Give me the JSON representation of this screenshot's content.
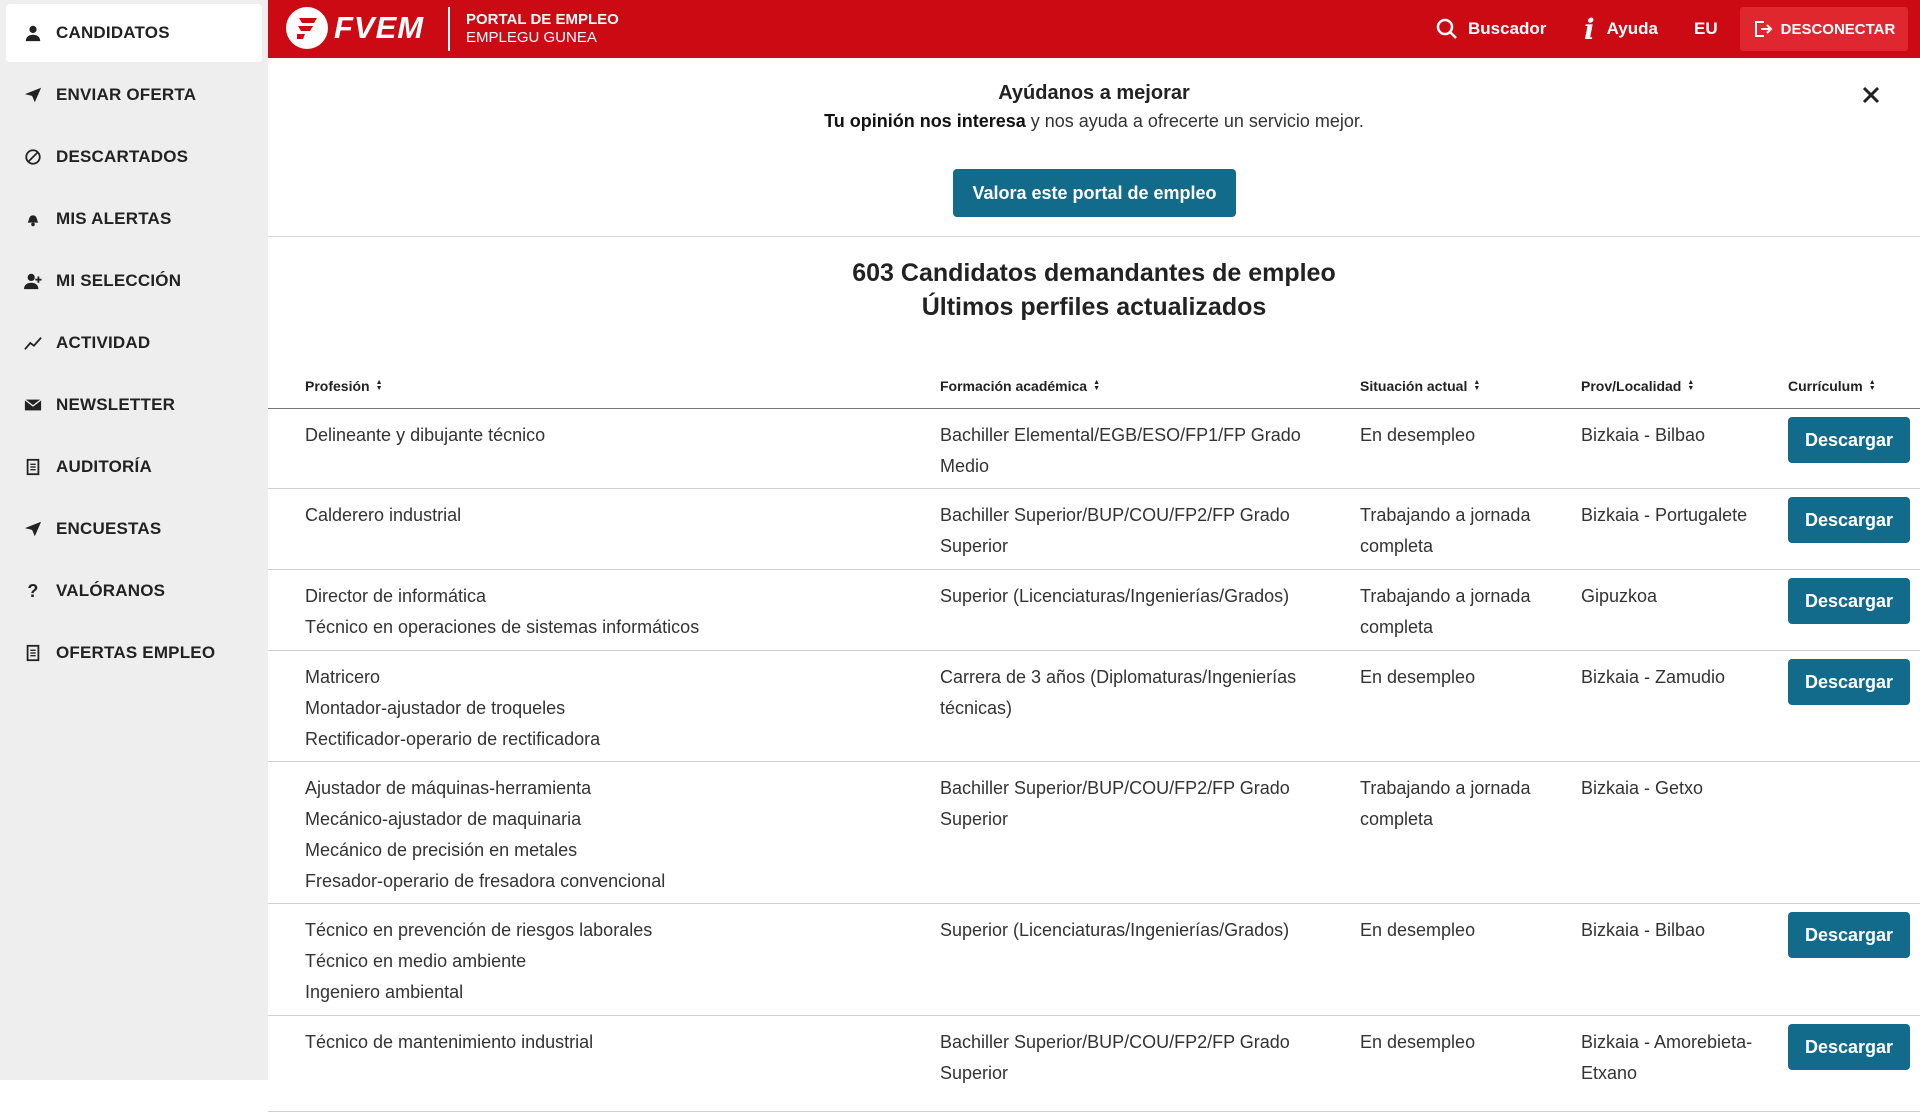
{
  "sidebar": {
    "items": [
      {
        "label": "CANDIDATOS",
        "icon": "user-icon"
      },
      {
        "label": "ENVIAR OFERTA",
        "icon": "send-icon"
      },
      {
        "label": "DESCARTADOS",
        "icon": "ban-icon"
      },
      {
        "label": "MIS ALERTAS",
        "icon": "bell-icon"
      },
      {
        "label": "MI SELECCIÓN",
        "icon": "user-plus-icon"
      },
      {
        "label": "ACTIVIDAD",
        "icon": "chart-line-icon"
      },
      {
        "label": "NEWSLETTER",
        "icon": "envelope-icon"
      },
      {
        "label": "AUDITORÍA",
        "icon": "document-icon"
      },
      {
        "label": "ENCUESTAS",
        "icon": "send-icon"
      },
      {
        "label": "VALÓRANOS",
        "icon": "question-icon"
      },
      {
        "label": "OFERTAS EMPLEO",
        "icon": "document-icon"
      }
    ]
  },
  "header": {
    "logo_text": "FVEM",
    "portal_line1": "PORTAL DE EMPLEO",
    "portal_line2": "EMPLEGU GUNEA",
    "search_label": "Buscador",
    "help_label": "Ayuda",
    "lang_label": "EU",
    "logout_label": "DESCONECTAR",
    "brand_color": "#cc0a13"
  },
  "feedback": {
    "title": "Ayúdanos a mejorar",
    "subtitle_bold": "Tu opinión nos interesa",
    "subtitle_rest": " y nos ayuda a ofrecerte un servicio mejor.",
    "button_label": "Valora este portal de empleo"
  },
  "main": {
    "title_line1": "603 Candidatos demandantes de empleo",
    "title_line2": "Últimos perfiles actualizados"
  },
  "table": {
    "headers": [
      "Profesión",
      "Formación académica",
      "Situación actual",
      "Prov/Localidad",
      "Currículum"
    ],
    "download_label": "Descargar",
    "rows": [
      {
        "profesion": [
          "Delineante y dibujante técnico"
        ],
        "formacion": "Bachiller Elemental/EGB/ESO/FP1/FP Grado Medio",
        "situacion": "En desempleo",
        "localidad": "Bizkaia - Bilbao",
        "has_cv": true
      },
      {
        "profesion": [
          "Calderero industrial"
        ],
        "formacion": "Bachiller Superior/BUP/COU/FP2/FP Grado Superior",
        "situacion": "Trabajando a jornada completa",
        "localidad": "Bizkaia - Portugalete",
        "has_cv": true
      },
      {
        "profesion": [
          "Director de informática",
          "Técnico en operaciones de sistemas informáticos"
        ],
        "formacion": "Superior (Licenciaturas/Ingenierías/Grados)",
        "situacion": "Trabajando a jornada completa",
        "localidad": "Gipuzkoa",
        "has_cv": true
      },
      {
        "profesion": [
          "Matricero",
          "Montador-ajustador de troqueles",
          "Rectificador-operario de rectificadora"
        ],
        "formacion": "Carrera de 3 años (Diplomaturas/Ingenierías técnicas)",
        "situacion": "En desempleo",
        "localidad": "Bizkaia - Zamudio",
        "has_cv": true
      },
      {
        "profesion": [
          "Ajustador de máquinas-herramienta",
          "Mecánico-ajustador de maquinaria",
          "Mecánico de precisión en metales",
          "Fresador-operario de fresadora convencional"
        ],
        "formacion": "Bachiller Superior/BUP/COU/FP2/FP Grado Superior",
        "situacion": "Trabajando a jornada completa",
        "localidad": "Bizkaia - Getxo",
        "has_cv": false
      },
      {
        "profesion": [
          "Técnico en prevención de riesgos laborales",
          "Técnico en medio ambiente",
          "Ingeniero ambiental"
        ],
        "formacion": "Superior (Licenciaturas/Ingenierías/Grados)",
        "situacion": "En desempleo",
        "localidad": "Bizkaia - Bilbao",
        "has_cv": true
      },
      {
        "profesion": [
          "Técnico de mantenimiento industrial"
        ],
        "formacion": "Bachiller Superior/BUP/COU/FP2/FP Grado Superior",
        "situacion": "En desempleo",
        "localidad": "Bizkaia - Amorebieta-Etxano",
        "has_cv": true
      }
    ]
  }
}
